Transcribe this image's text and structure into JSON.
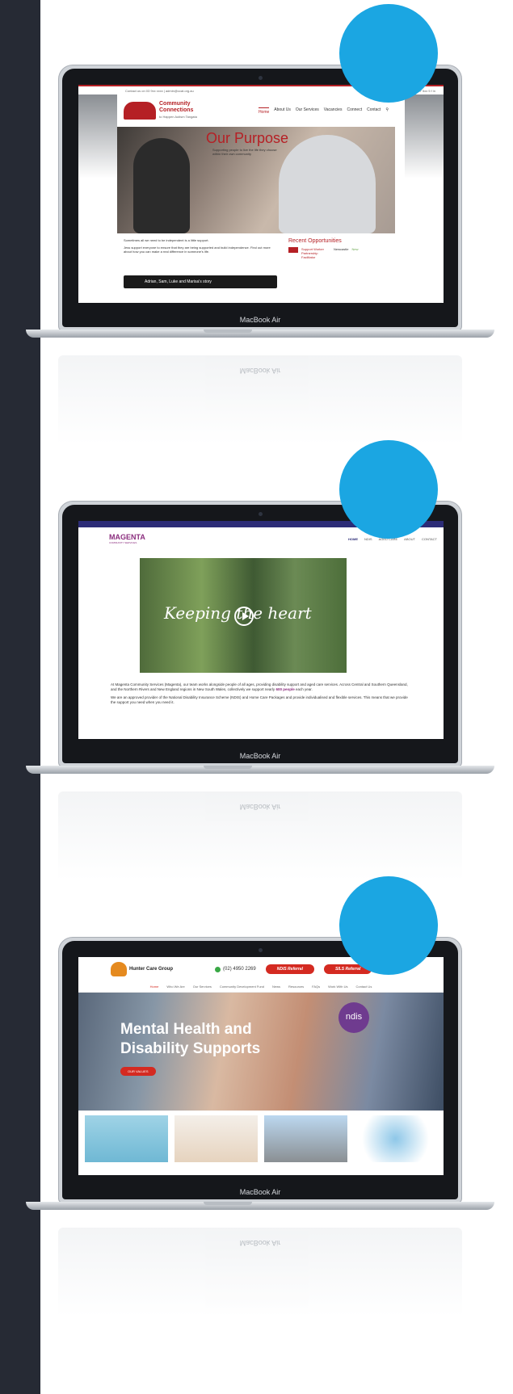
{
  "sidebar": {},
  "laptop": {
    "brand": "MacBook Air",
    "brand_mirror": "MacBook Air"
  },
  "site1": {
    "topbar_left": "Contact us on 03 9xx xxxx | admin@ccat.org.au",
    "topbar_right": "9637 5xx 5 f in",
    "logo_title": "Community Connections",
    "logo_subtitle": "to Happen Autism Tangata",
    "nav": [
      "Home",
      "About Us",
      "Our Services",
      "Vacancies",
      "Connect",
      "Contact"
    ],
    "hero_title": "Our Purpose",
    "hero_text": "Supporting people to live the life they choose within their own community",
    "body_intro": "Sometimes all we need to be independent is a little support.",
    "body_story": "Jess support everyone to ensure that they are being supported and build independence. Find out more about how you can make a real difference in someone's life.",
    "video_title": "Adrian, Sam, Luke and Marisa's story",
    "aside_title": "Recent Opportunities",
    "opportunity_link": "Support Worker Partnership Facilitator",
    "opportunity_place": "Newcastle",
    "opportunity_tag": "New"
  },
  "site2": {
    "logo": "MAGENTA",
    "logo_tag": "COMMUNITY SERVICES",
    "nav": [
      "HOME",
      "NDIS",
      "AGED CARE",
      "ABOUT",
      "CONTACT"
    ],
    "hero_title": "Keeping the heart",
    "para1_a": "At Magenta Community Services (Magenta), our team works alongside people of all ages, providing disability support and aged care services. Across Central and Southern Queensland, and the Northern Rivers and New England regions in New South Wales, collectively we support nearly",
    "para1_hl": "600 people",
    "para1_b": "each year.",
    "para2": "We are an approved provider of the National Disability Insurance Scheme (NDIS) and Home Care Packages and provide individualised and flexible services. This means that we provide the support you need when you need it."
  },
  "site3": {
    "logo": "Hunter Care Group",
    "phone": "(02) 4950 2269",
    "btn_ndis": "NDIS Referral",
    "btn_sils": "SILS Referral",
    "nav": [
      "Home",
      "Who We Are",
      "Our Services",
      "Community Development Fund",
      "News",
      "Resources",
      "FAQs",
      "Work With Us",
      "Contact Us"
    ],
    "hero_title": "Mental Health and Disability Supports",
    "hero_btn": "OUR VALUES",
    "badge": "ndis"
  },
  "colors": {
    "sidebar": "#262a34",
    "accent_circle": "#1ba6e2",
    "site1_red": "#b52025",
    "site2_purple": "#8b2e7e",
    "site3_red": "#d42a21"
  }
}
